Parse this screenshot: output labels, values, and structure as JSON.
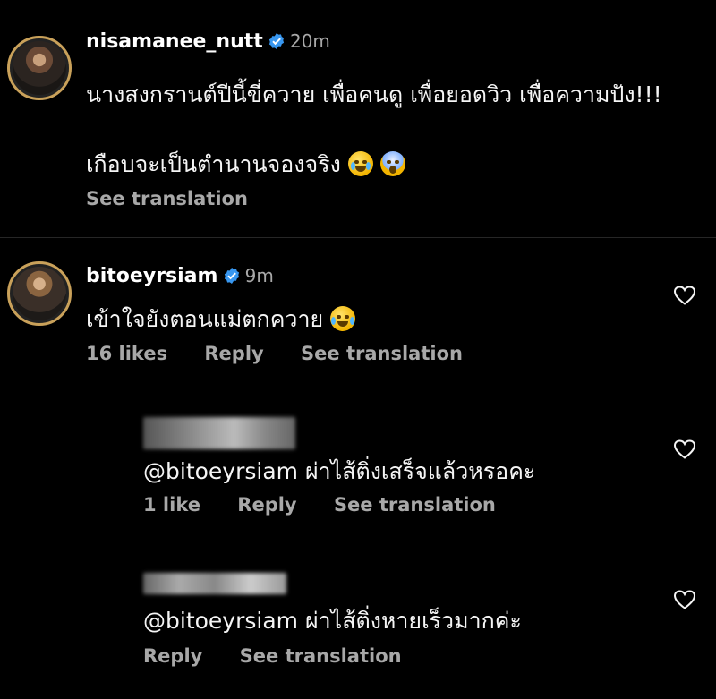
{
  "comments": [
    {
      "username": "nisamanee_nutt",
      "time": "20m",
      "line1": "นางสงกรานต์ปีนี้ขี่ควาย เพื่อคนดู เพื่อยอดวิว เพื่อความปัง!!!",
      "line2": "เกือบจะเป็นตำนานจองจริง",
      "see_translation": "See translation",
      "emojis": [
        "loudly-crying-face-emoji",
        "screaming-face-emoji"
      ]
    },
    {
      "username": "bitoeyrsiam",
      "time": "9m",
      "text": "เข้าใจยังตอนแม่ตกควาย",
      "likes": "16 likes",
      "reply": "Reply",
      "see_translation": "See translation",
      "emoji": "tears-of-joy-emoji"
    }
  ],
  "replies": [
    {
      "text": "@bitoeyrsiam ผ่าไส้ติ่งเสร็จแล้วหรอคะ",
      "likes": "1 like",
      "reply": "Reply",
      "see_translation": "See translation"
    },
    {
      "text": "@bitoeyrsiam ผ่าไส้ติ่งหายเร็วมากค่ะ",
      "reply": "Reply",
      "see_translation": "See translation"
    }
  ],
  "colors": {
    "background": "#000000",
    "secondary_text": "#a8a8a8",
    "verified_badge": "#3897f0"
  }
}
